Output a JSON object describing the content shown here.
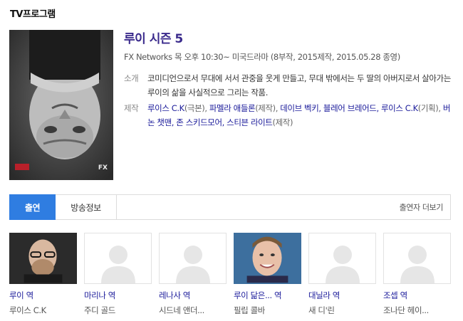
{
  "section_title": "TV프로그램",
  "show": {
    "title": "루이 시즌 5",
    "meta": "FX Networks 목 오후 10:30~ 미국드라마 (8부작, 2015제작, 2015.05.28 종영)",
    "synopsis_label": "소개",
    "synopsis": "코미디언으로서 무대에 서서 관중을 웃게 만들고, 무대 밖에서는 두 딸의 아버지로서 살아가는 루이의 삶을 사실적으로 그리는 작품.",
    "credits_label": "제작",
    "credits": [
      {
        "name": "루이스 C.K",
        "role": "(극본), "
      },
      {
        "name": "파멜라 애들론",
        "role": "(제작), "
      },
      {
        "name": "데이브 벡키, 블레어 브레어드, 루이스 C.K",
        "role": "(기획), "
      },
      {
        "name": "버논 챗맨, 존 스키드모어, 스티븐 라이트",
        "role": "(제작)"
      }
    ],
    "poster": {
      "corner_logo_left": "LOUIE",
      "corner_logo_right": "FX"
    }
  },
  "tabs": {
    "cast": "출연",
    "broadcast_info": "방송정보",
    "more": "출연자 더보기"
  },
  "cast": [
    {
      "role": "루이 역",
      "actor": "루이스 C.K",
      "photo": "dark"
    },
    {
      "role": "마리나 역",
      "actor": "주디 골드",
      "photo": "placeholder"
    },
    {
      "role": "레나사 역",
      "actor": "시드네 앤더...",
      "photo": "placeholder"
    },
    {
      "role": "루이 닮은... 역",
      "actor": "필립 콜바",
      "photo": "blue"
    },
    {
      "role": "대닐라 역",
      "actor": "새 디'린",
      "photo": "placeholder"
    },
    {
      "role": "조셉 역",
      "actor": "조나단 헤이...",
      "photo": "placeholder"
    }
  ],
  "colors": {
    "accent": "#2f7de1",
    "title": "#3a2a8c",
    "link": "#1a1a9a"
  }
}
